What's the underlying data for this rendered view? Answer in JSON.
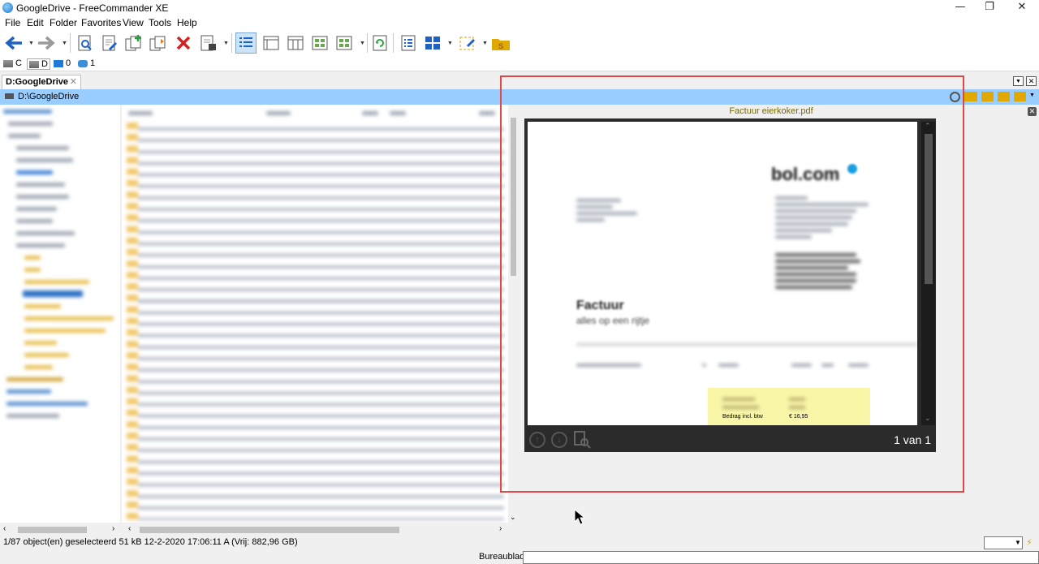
{
  "window": {
    "title": "GoogleDrive - FreeCommander XE",
    "minimize": "—",
    "maximize": "❐",
    "close": "✕"
  },
  "menu": [
    "File",
    "Edit",
    "Folder",
    "Favorites",
    "View",
    "Tools",
    "Help"
  ],
  "drives": [
    {
      "label": "C"
    },
    {
      "label": "D"
    },
    {
      "label": "0"
    },
    {
      "label": "1"
    }
  ],
  "tab": {
    "label": "D:GoogleDrive",
    "close": "✕"
  },
  "path": "D:\\GoogleDrive",
  "preview": {
    "filename": "Factuur eierkoker.pdf",
    "close": "✕",
    "page_info": "1 van 1",
    "doc": {
      "logo": "bol.com",
      "heading": "Factuur",
      "subheading": "alles op een rijtje",
      "total_label": "Bedrag incl. btw",
      "total_value": "€ 16,95"
    }
  },
  "status": {
    "text": "1/87 object(en) geselecteerd    51 kB   12-2-2020 17:06:11   A   (Vrij: 882,96 GB)"
  },
  "cmdline": {
    "label": "Bureaublad"
  },
  "colors": {
    "path_bar": "#99ccff",
    "highlight_border": "#e04848",
    "preview_title": "#7a6a00"
  }
}
